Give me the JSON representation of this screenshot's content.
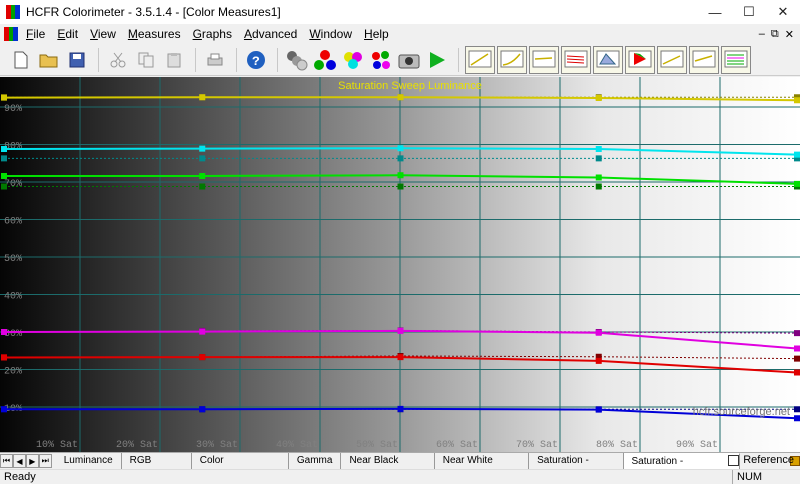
{
  "window": {
    "title": "HCFR Colorimeter - 3.5.1.4 - [Color Measures1]",
    "minimize": "—",
    "maximize": "☐",
    "close": "✕"
  },
  "menu": {
    "items": [
      "File",
      "Edit",
      "View",
      "Measures",
      "Graphs",
      "Advanced",
      "Window",
      "Help"
    ],
    "mdi_min": "–",
    "mdi_restore": "⧉",
    "mdi_close": "✕"
  },
  "toolbar": {
    "buttons": [
      "new-icon",
      "open-icon",
      "save-icon",
      "cut-icon",
      "copy-icon",
      "paste-icon",
      "print-icon",
      "help-icon",
      "gray-scale-icon",
      "primaries-icon",
      "secondaries-icon",
      "saturation-icon",
      "camera-icon",
      "play-icon"
    ],
    "graph_buttons": [
      "luminance-graph-icon",
      "gamma-graph-icon",
      "rgb-graph-icon",
      "color-temp-graph-icon",
      "cie-graph-icon",
      "near-black-graph-icon",
      "near-white-graph-icon",
      "sat-shift-graph-icon",
      "sat-lum-graph-icon"
    ]
  },
  "chart_data": {
    "type": "line",
    "title": "Saturation Sweep Luminance",
    "watermark_text": "hcfr.sourceforge.net",
    "xlabel": "",
    "ylabel": "",
    "x": [
      0,
      25,
      50,
      75,
      100
    ],
    "xlim": [
      0,
      100
    ],
    "ylim": [
      0,
      100
    ],
    "x_tick_labels": [
      "10% Sat",
      "20% Sat",
      "30% Sat",
      "40% Sat",
      "50% Sat",
      "60% Sat",
      "70% Sat",
      "80% Sat",
      "90% Sat"
    ],
    "y_tick_labels": [
      "10%",
      "20%",
      "30%",
      "40%",
      "50%",
      "60%",
      "70%",
      "80%",
      "90%"
    ],
    "grid": true,
    "series": [
      {
        "color": "#d4c800",
        "values": [
          92.5,
          92.6,
          92.6,
          92.4,
          91.8
        ],
        "ref_values": [
          92.6,
          92.6,
          92.6,
          92.6,
          92.6
        ],
        "ref_color": "#8a8200"
      },
      {
        "color": "#00e5ee",
        "values": [
          78.8,
          78.9,
          79.0,
          78.8,
          77.3
        ],
        "ref_values": [
          76.3,
          76.3,
          76.3,
          76.3,
          76.3
        ],
        "ref_color": "#008a8c"
      },
      {
        "color": "#00e000",
        "values": [
          71.6,
          71.6,
          71.8,
          71.2,
          69.5
        ],
        "ref_values": [
          68.8,
          68.8,
          68.8,
          68.8,
          68.8
        ],
        "ref_color": "#007a00"
      },
      {
        "color": "#e000e0",
        "values": [
          30.0,
          30.1,
          30.3,
          29.8,
          25.6
        ],
        "ref_values": [
          30.0,
          30.3,
          30.4,
          30.0,
          29.7
        ],
        "ref_color": "#800080"
      },
      {
        "color": "#e00000",
        "values": [
          23.2,
          23.3,
          23.3,
          22.3,
          19.2
        ],
        "ref_values": [
          23.3,
          23.3,
          23.6,
          23.4,
          22.9
        ],
        "ref_color": "#800000"
      },
      {
        "color": "#0000d8",
        "values": [
          9.4,
          9.4,
          9.5,
          9.3,
          7.0
        ],
        "ref_values": [
          9.4,
          9.4,
          9.4,
          9.4,
          9.4
        ],
        "ref_color": "#000080"
      }
    ]
  },
  "tabs": {
    "nav": [
      "⏮",
      "◀",
      "▶",
      "⏭"
    ],
    "items": [
      "Luminance",
      "RGB Levels",
      "Color temperature",
      "Gamma",
      "Near Black Scale",
      "Near White Scale",
      "Saturation - shifts",
      "Saturation - luminance"
    ],
    "active_index": 7,
    "reference_label": "Reference"
  },
  "status": {
    "ready": "Ready",
    "num": "NUM"
  }
}
